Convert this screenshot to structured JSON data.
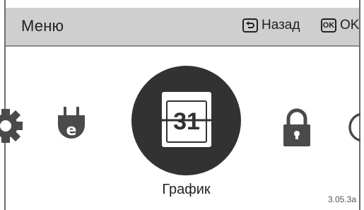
{
  "header": {
    "title": "Меню",
    "back_key_icon": "return-arrow-icon",
    "back_label": "Назад",
    "ok_key_text": "OK",
    "ok_label": "OK"
  },
  "carousel": {
    "items": [
      {
        "icon": "gear-icon"
      },
      {
        "icon": "plug-e-icon",
        "glyph": "e"
      },
      {
        "icon": "calendar-icon",
        "glyph": "31",
        "label": "График",
        "selected": true
      },
      {
        "icon": "lock-icon"
      },
      {
        "icon": "circle-icon"
      }
    ]
  },
  "footer": {
    "version": "3.05.3a"
  },
  "colors": {
    "header_bg": "#cfcfcf",
    "icon_dark": "#4a4a4a",
    "selected_disc": "#323232",
    "text": "#222222"
  }
}
